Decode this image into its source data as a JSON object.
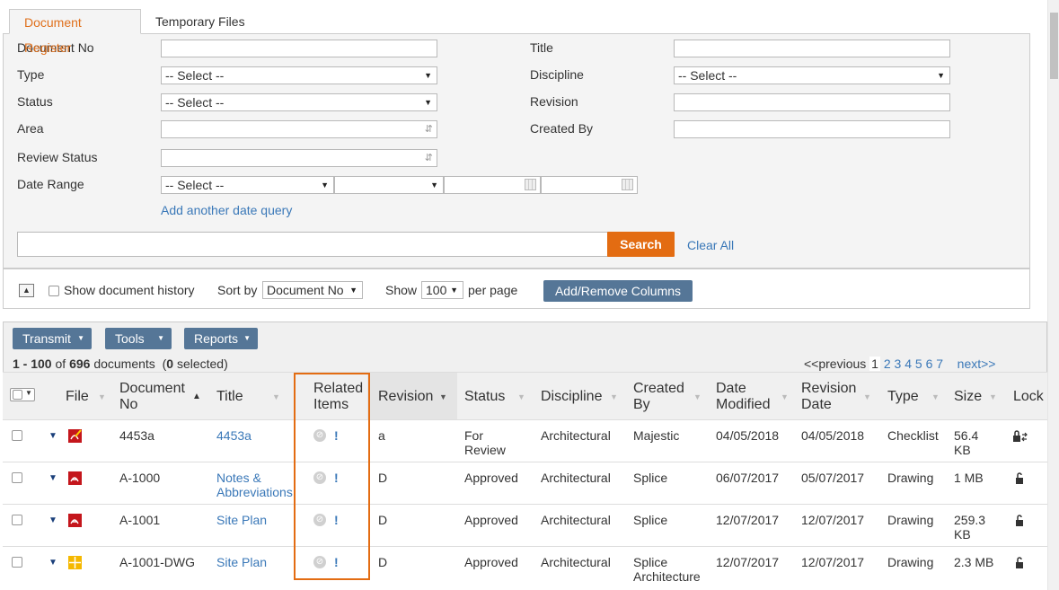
{
  "tabs": [
    {
      "label": "Document Register",
      "active": true
    },
    {
      "label": "Temporary Files",
      "active": false
    }
  ],
  "filters": {
    "document_no_label": "Document No",
    "type_label": "Type",
    "type_value": "-- Select --",
    "status_label": "Status",
    "status_value": "-- Select --",
    "area_label": "Area",
    "review_status_label": "Review Status",
    "date_range_label": "Date Range",
    "date_range_value": "-- Select --",
    "add_date_query": "Add another date query",
    "title_label": "Title",
    "discipline_label": "Discipline",
    "discipline_value": "-- Select --",
    "revision_label": "Revision",
    "created_by_label": "Created By",
    "search_button": "Search",
    "clear_all": "Clear All"
  },
  "options": {
    "show_history": "Show document history",
    "sort_by_label": "Sort by",
    "sort_by_value": "Document No",
    "show_label": "Show",
    "show_value": "100",
    "per_page": "per page",
    "add_remove_columns": "Add/Remove Columns"
  },
  "toolbar": {
    "transmit": "Transmit",
    "tools": "Tools",
    "reports": "Reports"
  },
  "summary": {
    "range": "1 - 100",
    "of": "of",
    "total": "696",
    "documents": "documents",
    "selected_open": "(",
    "selected_count": "0",
    "selected_close": "selected)"
  },
  "pagination": {
    "previous": "<<previous",
    "pages": [
      "1",
      "2",
      "3",
      "4",
      "5",
      "6",
      "7"
    ],
    "current": "1",
    "next": "next>>"
  },
  "columns": {
    "file": "File",
    "document_no_1": "Document",
    "document_no_2": "No",
    "title": "Title",
    "related_1": "Related",
    "related_2": "Items",
    "revision": "Revision",
    "status": "Status",
    "discipline": "Discipline",
    "created_by_1": "Created",
    "created_by_2": "By",
    "date_modified_1": "Date",
    "date_modified_2": "Modified",
    "revision_date_1": "Revision",
    "revision_date_2": "Date",
    "type": "Type",
    "size": "Size",
    "lock": "Lock"
  },
  "rows": [
    {
      "doc_no": "4453a",
      "title": "4453a",
      "title2": "",
      "related_mark": "!",
      "revision": "a",
      "status": "For",
      "status2": "Review",
      "discipline": "Architectural",
      "created_by": "Majestic",
      "created_by2": "",
      "date_modified": "04/05/2018",
      "revision_date": "04/05/2018",
      "type": "Checklist",
      "size": "56.4",
      "size2": "KB",
      "file_icon": "pdf-signed-icon",
      "lock_icon": "lock-sync-icon"
    },
    {
      "doc_no": "A-1000",
      "title": "Notes &",
      "title2": "Abbreviations",
      "related_mark": "!",
      "revision": "D",
      "status": "Approved",
      "status2": "",
      "discipline": "Architectural",
      "created_by": "Splice",
      "created_by2": "",
      "date_modified": "06/07/2017",
      "revision_date": "05/07/2017",
      "type": "Drawing",
      "size": "1 MB",
      "size2": "",
      "file_icon": "pdf-icon",
      "lock_icon": "unlock-icon"
    },
    {
      "doc_no": "A-1001",
      "title": "Site Plan",
      "title2": "",
      "related_mark": "!",
      "revision": "D",
      "status": "Approved",
      "status2": "",
      "discipline": "Architectural",
      "created_by": "Splice",
      "created_by2": "",
      "date_modified": "12/07/2017",
      "revision_date": "12/07/2017",
      "type": "Drawing",
      "size": "259.3",
      "size2": "KB",
      "file_icon": "pdf-icon",
      "lock_icon": "unlock-icon"
    },
    {
      "doc_no": "A-1001-DWG",
      "title": "Site Plan",
      "title2": "",
      "related_mark": "!",
      "revision": "D",
      "status": "Approved",
      "status2": "",
      "discipline": "Architectural",
      "created_by": "Splice",
      "created_by2": "Architecture",
      "date_modified": "12/07/2017",
      "revision_date": "12/07/2017",
      "type": "Drawing",
      "size": "2.3 MB",
      "size2": "",
      "file_icon": "dwg-icon",
      "lock_icon": "unlock-icon"
    }
  ],
  "colors": {
    "accent": "#e36c12",
    "button_blue": "#557697",
    "link": "#3a78b8",
    "pdf_red": "#c4161c",
    "dwg_yellow": "#f5b800"
  }
}
